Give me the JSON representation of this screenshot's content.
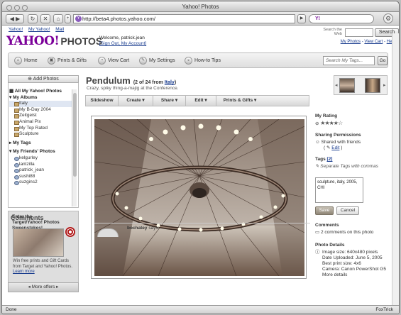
{
  "browser": {
    "title": "Yahoo! Photos",
    "url": "http://beta4.photos.yahoo.com/",
    "search_engine": "Y!",
    "bookmarks": [
      "Yahoo!",
      "My Yahoo!",
      "Mail"
    ],
    "status_left": "Done",
    "status_right": "FoxTrick"
  },
  "header": {
    "logo": "YAHOO!",
    "logo_sub": "PHOTOS",
    "welcome": "Welcome, patrick.jean",
    "signout": "[Sign Out, My Account]",
    "search_label": "Search the Web",
    "search_button": "Search",
    "top_links": [
      "My Photos",
      "View Cart",
      "Help"
    ]
  },
  "nav": {
    "items": [
      "Home",
      "Prints & Gifts",
      "View Cart",
      "My Settings",
      "How-to Tips"
    ],
    "tags_placeholder": "Search My Tags...",
    "go": "Go"
  },
  "sidebar": {
    "add_photos": "Add Photos",
    "all_photos": "All My Yahoo! Photos",
    "my_albums": "My Albums",
    "albums": [
      "Italy",
      "My B-Day 2004",
      "Zeitgeist",
      "Animal Pix",
      "My Top Rated",
      "Sculpture"
    ],
    "my_tags": "My Tags",
    "friends_header": "My Friends' Photos",
    "friends": [
      "kelgurley",
      "lantzilla",
      "patrick_jean",
      "sushi88",
      "suzgins2"
    ],
    "promo_title": "Enter the Target/Yahoo! Photos Sweepstakes!",
    "promo_text": "Win free prints and Gift Cards from Target and Yahoo! Photos.",
    "promo_link": "Learn more",
    "more_offers": "More offers"
  },
  "photo": {
    "title": "Pendulum",
    "count": "(2 of 24 from",
    "album_link": "Italy",
    "count_close": ")",
    "description": "Crazy, spiky thing-a-majig at the Conference.",
    "actions": [
      "Slideshow",
      "Create",
      "Share",
      "Edit",
      "Prints & Gifts"
    ]
  },
  "details": {
    "rating_label": "My Rating",
    "rating_value": 4,
    "rating_max": 5,
    "sharing_label": "Sharing Permissions",
    "sharing_value": "Shared with friends",
    "edit": "Edit",
    "tags_label": "Tags",
    "tags_count": "[2]",
    "tags_hint": "Separate Tags with commas",
    "tags_value": "sculpture, italy, 2005, CHI",
    "save": "Save",
    "cancel": "Cancel",
    "comments_label": "Comments",
    "comments_count": "2 comments on this photo",
    "photo_details_label": "Photo Details",
    "image_size": "Image size: 640x480 pixels",
    "date_uploaded": "Date Uploaded: June 5, 2005",
    "best_print": "Best print size: 4x6",
    "camera": "Camera: Canon PowerShot G5",
    "more_details": "More details"
  },
  "comments": {
    "title": "Comments",
    "author": "bochatey",
    "says": "says:"
  }
}
